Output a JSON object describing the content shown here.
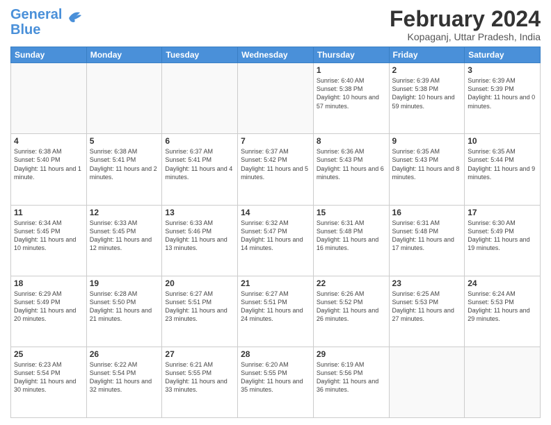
{
  "logo": {
    "line1": "General",
    "line2": "Blue"
  },
  "title": "February 2024",
  "subtitle": "Kopaganj, Uttar Pradesh, India",
  "days_of_week": [
    "Sunday",
    "Monday",
    "Tuesday",
    "Wednesday",
    "Thursday",
    "Friday",
    "Saturday"
  ],
  "weeks": [
    [
      {
        "day": "",
        "info": ""
      },
      {
        "day": "",
        "info": ""
      },
      {
        "day": "",
        "info": ""
      },
      {
        "day": "",
        "info": ""
      },
      {
        "day": "1",
        "info": "Sunrise: 6:40 AM\nSunset: 5:38 PM\nDaylight: 10 hours and 57 minutes."
      },
      {
        "day": "2",
        "info": "Sunrise: 6:39 AM\nSunset: 5:38 PM\nDaylight: 10 hours and 59 minutes."
      },
      {
        "day": "3",
        "info": "Sunrise: 6:39 AM\nSunset: 5:39 PM\nDaylight: 11 hours and 0 minutes."
      }
    ],
    [
      {
        "day": "4",
        "info": "Sunrise: 6:38 AM\nSunset: 5:40 PM\nDaylight: 11 hours and 1 minute."
      },
      {
        "day": "5",
        "info": "Sunrise: 6:38 AM\nSunset: 5:41 PM\nDaylight: 11 hours and 2 minutes."
      },
      {
        "day": "6",
        "info": "Sunrise: 6:37 AM\nSunset: 5:41 PM\nDaylight: 11 hours and 4 minutes."
      },
      {
        "day": "7",
        "info": "Sunrise: 6:37 AM\nSunset: 5:42 PM\nDaylight: 11 hours and 5 minutes."
      },
      {
        "day": "8",
        "info": "Sunrise: 6:36 AM\nSunset: 5:43 PM\nDaylight: 11 hours and 6 minutes."
      },
      {
        "day": "9",
        "info": "Sunrise: 6:35 AM\nSunset: 5:43 PM\nDaylight: 11 hours and 8 minutes."
      },
      {
        "day": "10",
        "info": "Sunrise: 6:35 AM\nSunset: 5:44 PM\nDaylight: 11 hours and 9 minutes."
      }
    ],
    [
      {
        "day": "11",
        "info": "Sunrise: 6:34 AM\nSunset: 5:45 PM\nDaylight: 11 hours and 10 minutes."
      },
      {
        "day": "12",
        "info": "Sunrise: 6:33 AM\nSunset: 5:45 PM\nDaylight: 11 hours and 12 minutes."
      },
      {
        "day": "13",
        "info": "Sunrise: 6:33 AM\nSunset: 5:46 PM\nDaylight: 11 hours and 13 minutes."
      },
      {
        "day": "14",
        "info": "Sunrise: 6:32 AM\nSunset: 5:47 PM\nDaylight: 11 hours and 14 minutes."
      },
      {
        "day": "15",
        "info": "Sunrise: 6:31 AM\nSunset: 5:48 PM\nDaylight: 11 hours and 16 minutes."
      },
      {
        "day": "16",
        "info": "Sunrise: 6:31 AM\nSunset: 5:48 PM\nDaylight: 11 hours and 17 minutes."
      },
      {
        "day": "17",
        "info": "Sunrise: 6:30 AM\nSunset: 5:49 PM\nDaylight: 11 hours and 19 minutes."
      }
    ],
    [
      {
        "day": "18",
        "info": "Sunrise: 6:29 AM\nSunset: 5:49 PM\nDaylight: 11 hours and 20 minutes."
      },
      {
        "day": "19",
        "info": "Sunrise: 6:28 AM\nSunset: 5:50 PM\nDaylight: 11 hours and 21 minutes."
      },
      {
        "day": "20",
        "info": "Sunrise: 6:27 AM\nSunset: 5:51 PM\nDaylight: 11 hours and 23 minutes."
      },
      {
        "day": "21",
        "info": "Sunrise: 6:27 AM\nSunset: 5:51 PM\nDaylight: 11 hours and 24 minutes."
      },
      {
        "day": "22",
        "info": "Sunrise: 6:26 AM\nSunset: 5:52 PM\nDaylight: 11 hours and 26 minutes."
      },
      {
        "day": "23",
        "info": "Sunrise: 6:25 AM\nSunset: 5:53 PM\nDaylight: 11 hours and 27 minutes."
      },
      {
        "day": "24",
        "info": "Sunrise: 6:24 AM\nSunset: 5:53 PM\nDaylight: 11 hours and 29 minutes."
      }
    ],
    [
      {
        "day": "25",
        "info": "Sunrise: 6:23 AM\nSunset: 5:54 PM\nDaylight: 11 hours and 30 minutes."
      },
      {
        "day": "26",
        "info": "Sunrise: 6:22 AM\nSunset: 5:54 PM\nDaylight: 11 hours and 32 minutes."
      },
      {
        "day": "27",
        "info": "Sunrise: 6:21 AM\nSunset: 5:55 PM\nDaylight: 11 hours and 33 minutes."
      },
      {
        "day": "28",
        "info": "Sunrise: 6:20 AM\nSunset: 5:55 PM\nDaylight: 11 hours and 35 minutes."
      },
      {
        "day": "29",
        "info": "Sunrise: 6:19 AM\nSunset: 5:56 PM\nDaylight: 11 hours and 36 minutes."
      },
      {
        "day": "",
        "info": ""
      },
      {
        "day": "",
        "info": ""
      }
    ]
  ]
}
